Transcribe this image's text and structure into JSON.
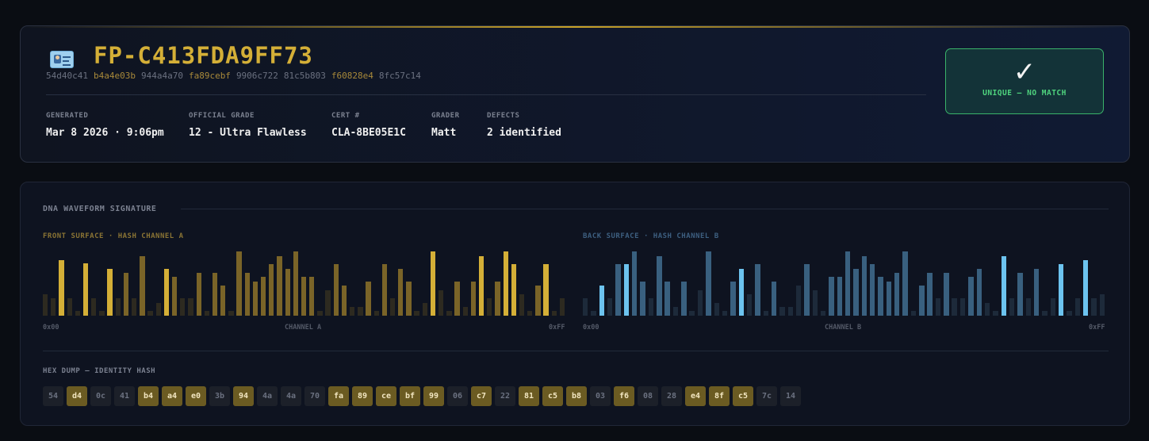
{
  "header": {
    "icon": "id-card-icon",
    "title": "FP-C413FDA9FF73",
    "hash_segments": [
      {
        "text": "54d40c41",
        "highlight": false
      },
      {
        "text": "b4a4e03b",
        "highlight": true
      },
      {
        "text": "944a4a70",
        "highlight": false
      },
      {
        "text": "fa89cebf",
        "highlight": true
      },
      {
        "text": "9906c722",
        "highlight": false
      },
      {
        "text": "81c5b803",
        "highlight": false
      },
      {
        "text": "f60828e4",
        "highlight": true
      },
      {
        "text": "8fc57c14",
        "highlight": false
      }
    ],
    "meta": [
      {
        "label": "GENERATED",
        "value": "Mar 8 2026 · 9:06pm"
      },
      {
        "label": "OFFICIAL GRADE",
        "value": "12 - Ultra Flawless"
      },
      {
        "label": "CERT #",
        "value": "CLA-8BE05E1C"
      },
      {
        "label": "GRADER",
        "value": "Matt"
      },
      {
        "label": "DEFECTS",
        "value": "2 identified"
      }
    ],
    "status": {
      "icon": "checkmark-icon",
      "glyph": "✓",
      "text": "UNIQUE — NO MATCH",
      "color": "#4fd47e"
    }
  },
  "waveform": {
    "section_title": "DNA WAVEFORM SIGNATURE",
    "channel_a": {
      "title": "FRONT SURFACE · HASH CHANNEL A",
      "axis_left": "0x00",
      "axis_center": "CHANNEL A",
      "axis_right": "0xFF",
      "color": "#d4af37",
      "values": [
        0.33,
        0.27,
        0.87,
        0.27,
        0.07,
        0.82,
        0.27,
        0.07,
        0.73,
        0.27,
        0.67,
        0.27,
        0.93,
        0.07,
        0.2,
        0.73,
        0.6,
        0.27,
        0.27,
        0.67,
        0.07,
        0.67,
        0.47,
        0.07,
        1.0,
        0.67,
        0.53,
        0.6,
        0.8,
        0.93,
        0.73,
        1.0,
        0.6,
        0.6,
        0.07,
        0.4,
        0.8,
        0.47,
        0.13,
        0.13,
        0.53,
        0.07,
        0.8,
        0.27,
        0.73,
        0.53,
        0.07,
        0.2,
        1.0,
        0.4,
        0.07,
        0.53,
        0.13,
        0.53,
        0.93,
        0.27,
        0.53,
        1.0,
        0.8,
        0.33,
        0.07,
        0.47,
        0.8,
        0.07,
        0.27
      ],
      "intensity": [
        1,
        1,
        3,
        1,
        1,
        3,
        1,
        1,
        3,
        1,
        2,
        1,
        2,
        1,
        1,
        3,
        2,
        1,
        1,
        2,
        1,
        2,
        2,
        1,
        2,
        2,
        2,
        2,
        2,
        2,
        2,
        2,
        2,
        2,
        1,
        1,
        2,
        2,
        1,
        1,
        2,
        1,
        2,
        1,
        2,
        2,
        1,
        1,
        3,
        1,
        1,
        2,
        1,
        2,
        3,
        1,
        2,
        3,
        3,
        1,
        1,
        2,
        3,
        1,
        1
      ]
    },
    "channel_b": {
      "title": "BACK SURFACE · HASH CHANNEL B",
      "axis_left": "0x00",
      "axis_center": "CHANNEL B",
      "axis_right": "0xFF",
      "color": "#6cc3ef",
      "values": [
        0.27,
        0.07,
        0.47,
        0.27,
        0.8,
        0.8,
        1.0,
        0.53,
        0.27,
        0.93,
        0.53,
        0.13,
        0.53,
        0.07,
        0.4,
        1.0,
        0.2,
        0.07,
        0.53,
        0.73,
        0.33,
        0.8,
        0.07,
        0.53,
        0.13,
        0.13,
        0.47,
        0.8,
        0.4,
        0.07,
        0.6,
        0.6,
        1.0,
        0.73,
        0.93,
        0.8,
        0.6,
        0.53,
        0.67,
        1.0,
        0.07,
        0.47,
        0.67,
        0.27,
        0.67,
        0.27,
        0.27,
        0.6,
        0.73,
        0.2,
        0.07,
        0.93,
        0.27,
        0.67,
        0.27,
        0.73,
        0.07,
        0.27,
        0.8,
        0.07,
        0.27,
        0.87,
        0.27,
        0.33
      ],
      "intensity": [
        1,
        1,
        3,
        1,
        2,
        3,
        2,
        2,
        1,
        2,
        2,
        1,
        2,
        1,
        1,
        2,
        1,
        1,
        2,
        3,
        1,
        2,
        1,
        2,
        1,
        1,
        1,
        2,
        1,
        1,
        2,
        2,
        2,
        2,
        2,
        2,
        2,
        2,
        2,
        2,
        1,
        2,
        2,
        1,
        2,
        1,
        1,
        2,
        2,
        1,
        1,
        3,
        1,
        2,
        1,
        2,
        1,
        1,
        3,
        1,
        1,
        3,
        1,
        1
      ]
    }
  },
  "hexdump": {
    "title": "HEX DUMP — IDENTITY HASH",
    "bytes": [
      {
        "v": "54",
        "hl": false
      },
      {
        "v": "d4",
        "hl": true
      },
      {
        "v": "0c",
        "hl": false
      },
      {
        "v": "41",
        "hl": false
      },
      {
        "v": "b4",
        "hl": true
      },
      {
        "v": "a4",
        "hl": true
      },
      {
        "v": "e0",
        "hl": true
      },
      {
        "v": "3b",
        "hl": false
      },
      {
        "v": "94",
        "hl": true
      },
      {
        "v": "4a",
        "hl": false
      },
      {
        "v": "4a",
        "hl": false
      },
      {
        "v": "70",
        "hl": false
      },
      {
        "v": "fa",
        "hl": true
      },
      {
        "v": "89",
        "hl": true
      },
      {
        "v": "ce",
        "hl": true
      },
      {
        "v": "bf",
        "hl": true
      },
      {
        "v": "99",
        "hl": true
      },
      {
        "v": "06",
        "hl": false
      },
      {
        "v": "c7",
        "hl": true
      },
      {
        "v": "22",
        "hl": false
      },
      {
        "v": "81",
        "hl": true
      },
      {
        "v": "c5",
        "hl": true
      },
      {
        "v": "b8",
        "hl": true
      },
      {
        "v": "03",
        "hl": false
      },
      {
        "v": "f6",
        "hl": true
      },
      {
        "v": "08",
        "hl": false
      },
      {
        "v": "28",
        "hl": false
      },
      {
        "v": "e4",
        "hl": true
      },
      {
        "v": "8f",
        "hl": true
      },
      {
        "v": "c5",
        "hl": true
      },
      {
        "v": "7c",
        "hl": false
      },
      {
        "v": "14",
        "hl": false
      }
    ]
  }
}
